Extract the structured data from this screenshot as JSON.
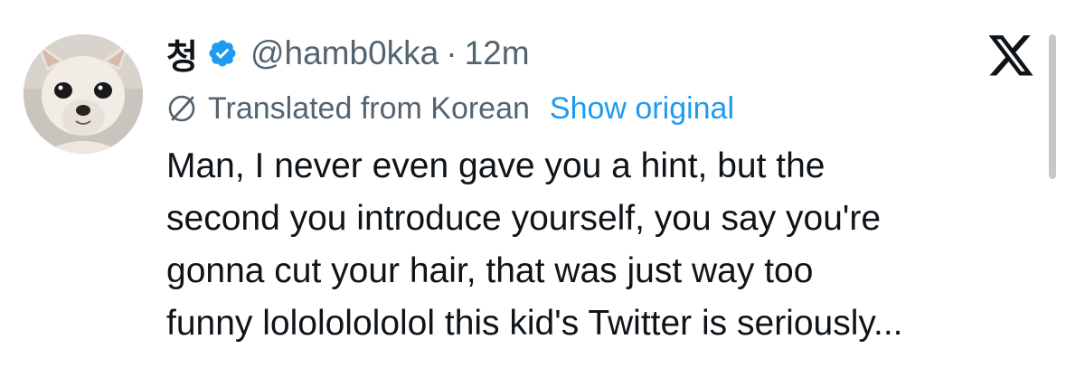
{
  "author": {
    "display_name": "청",
    "handle": "@hamb0kka",
    "separator": "·",
    "time": "12m",
    "verified": true
  },
  "translation": {
    "label": "Translated from Korean",
    "show_original": "Show original"
  },
  "tweet": {
    "lines": [
      "Man, I never even gave you a hint, but the",
      "second you introduce yourself, you say you're",
      "gonna cut your hair, that was just way too",
      "funny lolololololol this kid's Twitter is seriously..."
    ]
  },
  "icons": {
    "verified": "verified-badge-icon",
    "translate": "globe-slash-icon",
    "brand": "x-logo-icon"
  },
  "colors": {
    "text": "#0f1419",
    "secondary": "#536471",
    "link": "#1d9bf0",
    "verified": "#1d9bf0"
  }
}
